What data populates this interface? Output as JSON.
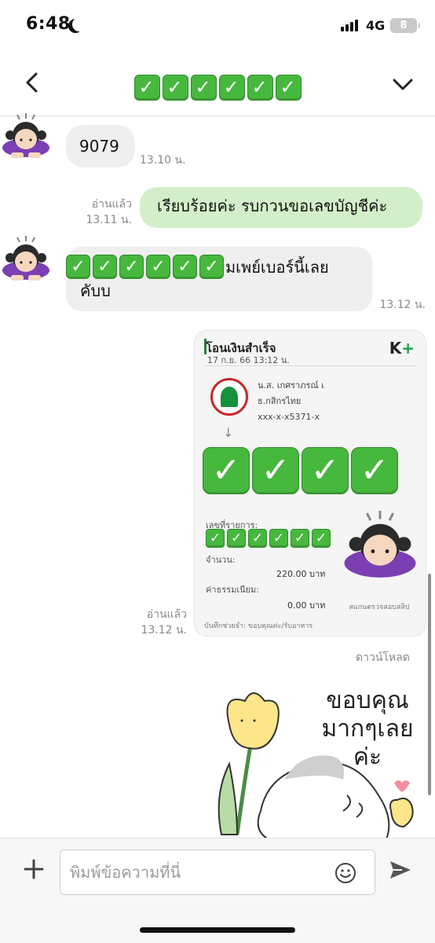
{
  "status_bar": {
    "time": "6:48",
    "network": "4G",
    "battery": "8"
  },
  "header": {
    "title_checks": [
      "✓",
      "✓",
      "✓",
      "✓",
      "✓",
      "✓"
    ]
  },
  "messages": {
    "m1": {
      "text": "9079",
      "time": "13.10 น."
    },
    "m2": {
      "text": "เรียบร้อยค่ะ รบกวนขอเลขบัญชีค่ะ",
      "read": "อ่านแล้ว",
      "time": "13.11 น."
    },
    "m3": {
      "text_line1": "มเพย์เบอร์นี้เลย",
      "text_line2": "คับบ",
      "time": "13.12 น."
    },
    "m4": {
      "read": "อ่านแล้ว",
      "time": "13.12 น."
    }
  },
  "receipt": {
    "title": "โอนเงินสำเร็จ",
    "date": "17 ก.ย. 66  13:12 น.",
    "logo": "K",
    "logo_plus": "+",
    "acct_name": "น.ส. เกศราภรณ์ เ",
    "bank": "ธ.กสิกรไทย",
    "acct_no": "xxx-x-x5371-x",
    "ref_label": "เลขที่รายการ:",
    "amount_label": "จำนวน:",
    "amount": "220.00 บาท",
    "fee_label": "ค่าธรรมเนียม:",
    "fee": "0.00 บาท",
    "scan_text": "สแกนตรวจสอบสลิป",
    "footer": "บันทึกช่วยจำ: ขอบคุณค่ะ/รับอาหาร"
  },
  "download_label": "ดาวน์โหลด",
  "sticker": {
    "text_line1": "ขอบคุณ",
    "text_line2": "มากๆเลย",
    "text_line3": "ค่ะ"
  },
  "composer": {
    "placeholder": "พิมพ์ข้อความที่นี่"
  },
  "icons": {
    "back": "chevron-left-icon",
    "menu": "chevron-down-icon",
    "add": "plus-icon",
    "emoji": "smiley-icon",
    "send": "send-icon"
  },
  "colors": {
    "outgoing_bubble": "#d3efc9",
    "incoming_bubble": "#efefef",
    "check_green": "#47b83e"
  }
}
